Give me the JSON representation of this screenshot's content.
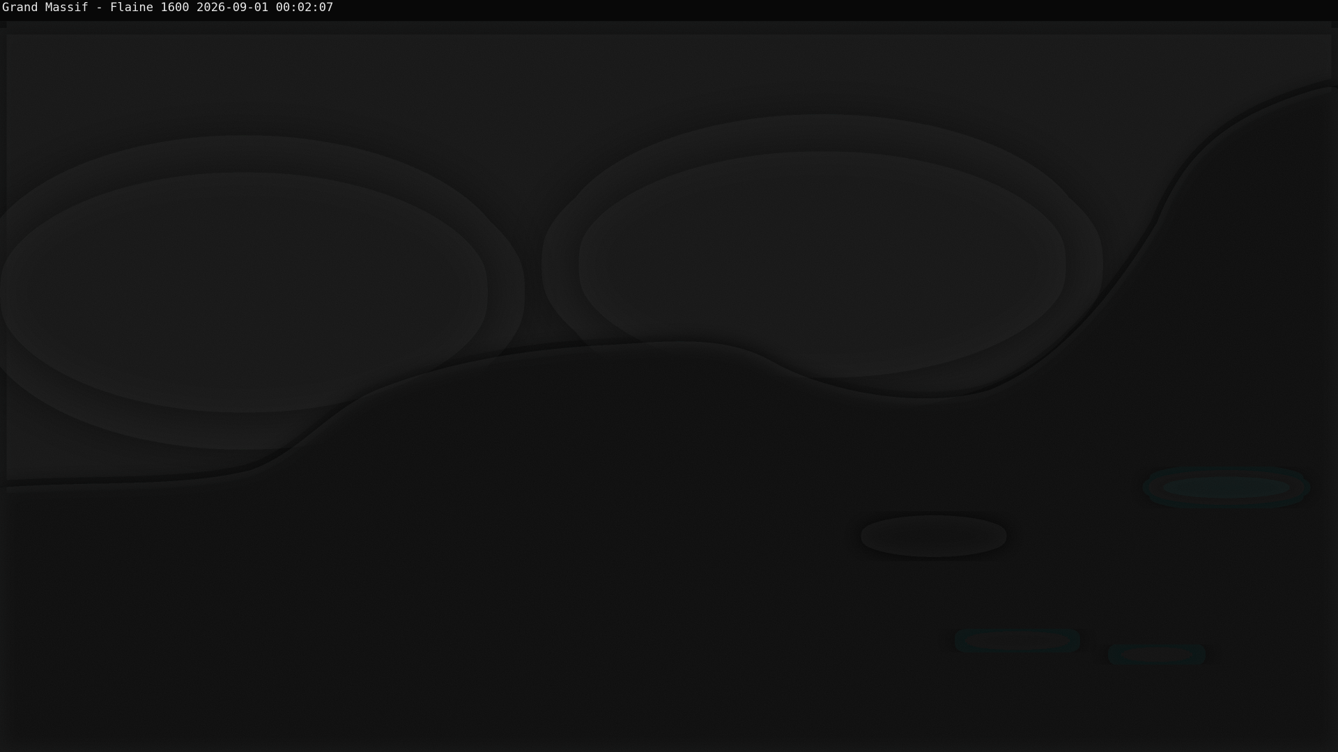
{
  "webcam": {
    "caption": "Grand Massif - Flaine 1600 2026-09-01 00:02:07"
  }
}
